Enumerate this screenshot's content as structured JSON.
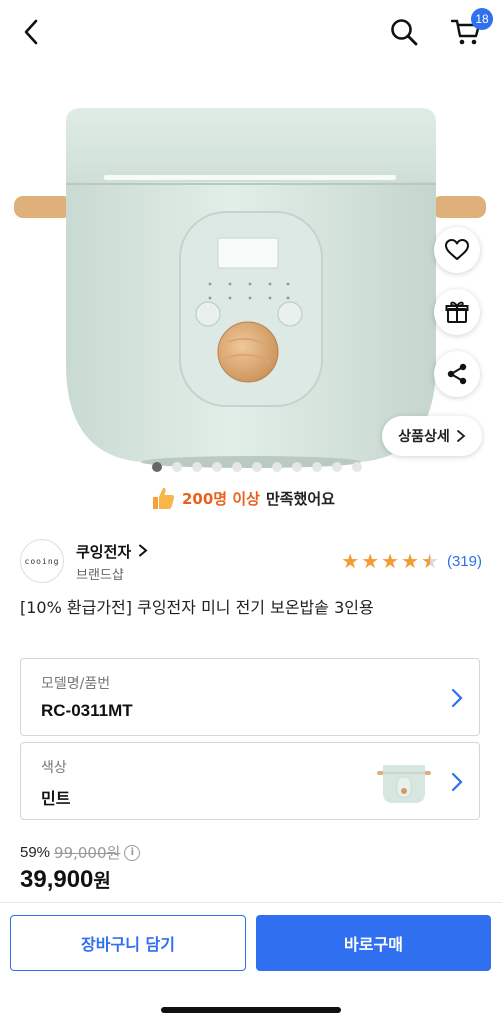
{
  "header": {
    "cart_badge": "18"
  },
  "hero": {
    "slide_count": 11,
    "active_slide": 1,
    "detail_button_label": "상품상세",
    "satisfaction_highlight": "200명 이상",
    "satisfaction_rest": "만족했어요"
  },
  "seller": {
    "logo_text": "cooing",
    "brand_name": "쿠잉전자",
    "brand_sub": "브랜드샵",
    "rating": 4.5,
    "review_count": "(319)"
  },
  "product": {
    "title": "[10% 환급가전] 쿠잉전자 미니 전기 보온밥솥 3인용"
  },
  "options": {
    "model": {
      "label": "모델명/품번",
      "value": "RC-0311MT"
    },
    "color": {
      "label": "색상",
      "value": "민트"
    }
  },
  "price": {
    "discount_rate": "59%",
    "original_price": "99,000원",
    "sale_price": "39,900",
    "currency": "원"
  },
  "bottom_bar": {
    "add_to_cart": "장바구니 담기",
    "buy_now": "바로구매"
  },
  "colors": {
    "accent": "#2f6ff0",
    "highlight": "#e8621d",
    "star": "#f39c35",
    "mint": "#d7e6df"
  }
}
